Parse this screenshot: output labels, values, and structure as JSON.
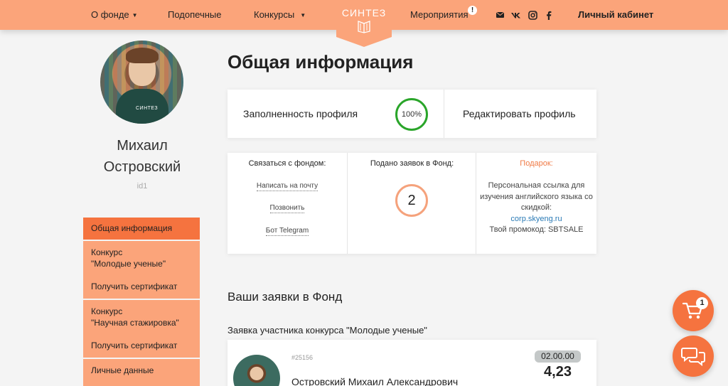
{
  "header": {
    "nav": {
      "about": "О фонде",
      "wards": "Подопечные",
      "contests": "Конкурсы",
      "events": "Мероприятия",
      "cabinet": "Личный кабинет"
    },
    "logo": "СИНТЕЗ",
    "events_badge": "!"
  },
  "profile": {
    "name": "Михаил Островский",
    "id": "id1",
    "shirt_brand": "СИНТЕЗ"
  },
  "sidebar": {
    "items": [
      {
        "label": "Общая информация",
        "active": true
      },
      {
        "label": "Конкурс\n\"Молодые ученые\""
      },
      {
        "label": "Получить сертификат"
      },
      {
        "label": "Конкурс\n\"Научная стажировка\""
      },
      {
        "label": "Получить сертификат"
      },
      {
        "label": "Личные данные"
      }
    ]
  },
  "main": {
    "title": "Общая информация",
    "completeness_label": "Заполненность профиля",
    "completeness_value": "100%",
    "edit_profile": "Редактировать профиль",
    "contact": {
      "title": "Связаться с фондом:",
      "email": "Написать на почту",
      "call": "Позвонить",
      "telegram": "Бот Telegram"
    },
    "applications": {
      "title": "Подано заявок в Фонд:",
      "count": "2"
    },
    "gift": {
      "title": "Подарок:",
      "text": "Персональная ссылка для изучения английского языка со скидкой:",
      "link": "corp.skyeng.ru",
      "promo": "Твой промокод: SBTSALE"
    },
    "apps_section_title": "Ваши заявки в Фонд",
    "app": {
      "heading": "Заявка участника конкурса \"Молодые ученые\"",
      "number": "#25156",
      "name": "Островский Михаил Александрович",
      "score_label": "02.00.00",
      "score": "4,23"
    }
  },
  "floating": {
    "cart_count": "1"
  },
  "colors": {
    "header": "#fba47a",
    "accent": "#f5733f",
    "ring_green": "#2aa52a",
    "gift_orange": "#f07a45"
  }
}
